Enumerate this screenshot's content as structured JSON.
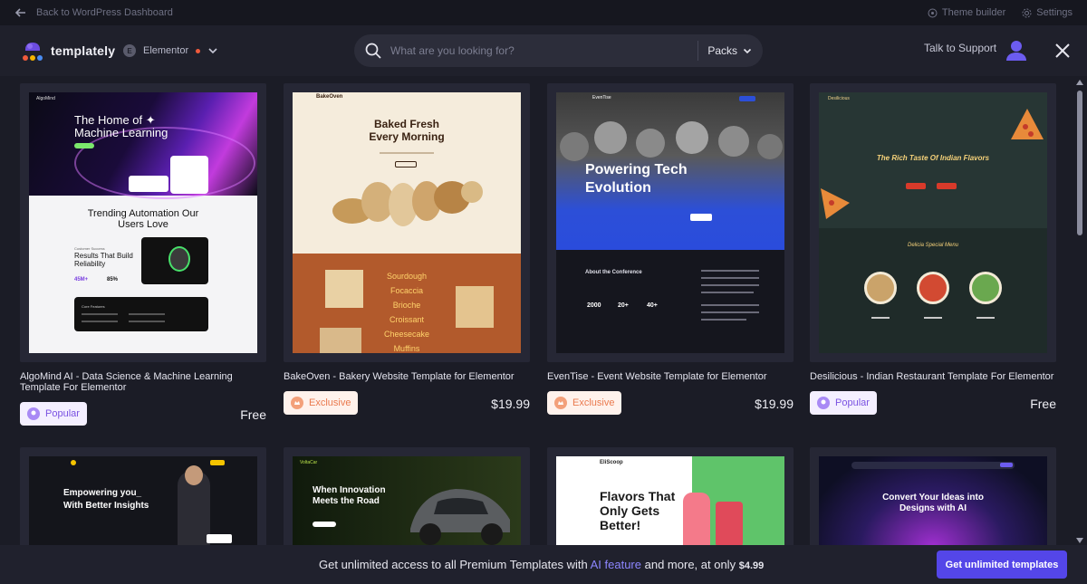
{
  "topbar": {
    "back_label": "Back to WordPress Dashboard",
    "theme_builder": "Theme builder",
    "settings": "Settings"
  },
  "header": {
    "logo": "templately",
    "builder": "Elementor",
    "search_placeholder": "What are you looking for?",
    "search_type": "Packs",
    "support": "Talk to Support"
  },
  "templates": [
    {
      "title": "AlgoMind AI - Data Science & Machine Learning Template For Elementor",
      "badge": "Popular",
      "price": "Free",
      "preview": {
        "hero_title": "The Home of ✦ Machine Learning",
        "section_title": "Trending Automation Our Users Love",
        "card_title": "Results That Build Reliability",
        "stat_1": "45M+",
        "stat_2": "85%",
        "features": "Core Features"
      }
    },
    {
      "title": "BakeOven - Bakery Website Template for Elementor",
      "badge": "Exclusive",
      "price": "$19.99",
      "preview": {
        "brand": "BakeOven",
        "hero_title": "Baked Fresh Every Morning",
        "menu": [
          "Sourdough",
          "Focaccia",
          "Brioche",
          "Croissant",
          "Cheesecake",
          "Muffins"
        ]
      }
    },
    {
      "title": "EvenTise - Event Website Template for Elementor",
      "badge": "Exclusive",
      "price": "$19.99",
      "preview": {
        "brand": "EvenTise",
        "hero_title": "Powering Tech Evolution",
        "about": "About the Conference",
        "stats": [
          "2000",
          "20+",
          "40+"
        ]
      }
    },
    {
      "title": "Desilicious - Indian Restaurant Template For Elementor",
      "badge": "Popular",
      "price": "Free",
      "preview": {
        "brand": "Desilicious",
        "hero_title": "The Rich Taste Of Indian Flavors",
        "menu_title": "Delicia Special Menu"
      }
    }
  ],
  "templates_row2": [
    {
      "preview_title": "Empowering you_ With Better Insights"
    },
    {
      "preview_title": "When Innovation Meets the Road",
      "brand": "VoltaCar"
    },
    {
      "preview_title": "Flavors That Only Gets Better!",
      "brand": "EliScoop"
    },
    {
      "preview_title": "Convert Your Ideas into Designs with AI"
    }
  ],
  "banner": {
    "message_start": "Get unlimited access to all Premium Templates with",
    "ai_feature": "AI feature",
    "message_end": "and more, at only",
    "amount": "$4.99",
    "cta": "Get unlimited templates"
  },
  "colors": {
    "accent": "#5446e8",
    "popular_text": "#7a52e2",
    "exclusive_text": "#ea7a4e"
  }
}
